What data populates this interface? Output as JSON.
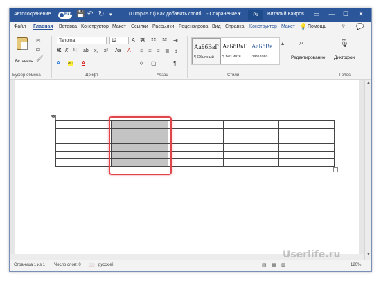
{
  "titlebar": {
    "autosave_label": "Автосохранение",
    "autosave_state": "Вкл",
    "doc_title": "(Lumpics.ru) Как добавить столб... - Сохранение...",
    "caret": "▾",
    "mini_button": "Ра",
    "user": "Виталий Каиров",
    "save_icon": "💾",
    "undo_icon": "↶",
    "redo_icon": "↻",
    "qa_more": "▾",
    "ribbon_opts_icon": "▭",
    "minimize_icon": "—",
    "maximize_icon": "☐",
    "close_icon": "✕"
  },
  "tabs": [
    {
      "label": "Файл"
    },
    {
      "label": "Главная"
    },
    {
      "label": "Вставка"
    },
    {
      "label": "Конструктор"
    },
    {
      "label": "Макет"
    },
    {
      "label": "Ссылки"
    },
    {
      "label": "Рассылки"
    },
    {
      "label": "Рецензирова"
    },
    {
      "label": "Вид"
    },
    {
      "label": "Справка"
    },
    {
      "label": "Конструктор"
    },
    {
      "label": "Макет"
    },
    {
      "label": "Помощь"
    }
  ],
  "tabs_icons": {
    "bulb": "💡",
    "share": "⇪",
    "comment": "💬"
  },
  "ribbon": {
    "clipboard": {
      "paste_label": "Вставить",
      "group_label": "Буфер обмена"
    },
    "font": {
      "name": "Tahoma",
      "size": "12",
      "group_label": "Шрифт",
      "bold": "Ж",
      "italic": "К",
      "underline": "Ч",
      "strike": "ab",
      "sub": "x₂",
      "sup": "x²",
      "grow": "A⁺",
      "shrink": "A⁻",
      "case": "Aa",
      "clear": "A",
      "effects": "A",
      "highlight": "ab",
      "color": "A"
    },
    "paragraph": {
      "group_label": "Абзац"
    },
    "styles": {
      "group_label": "Стили",
      "items": [
        {
          "sample": "АаБбВвГ",
          "name": "¶ Обычный"
        },
        {
          "sample": "АаБбВвГ",
          "name": "¶ Без инте..."
        },
        {
          "sample": "АаБбВв",
          "name": "Заголово..."
        }
      ]
    },
    "editing": {
      "label": "Редактирование",
      "icon": "⌕"
    },
    "voice": {
      "label": "Диктофон",
      "group_label": "Голос",
      "icon": "🎙"
    }
  },
  "table": {
    "rows": 6,
    "cols": 5,
    "selected_column": 2,
    "move_icon": "✥"
  },
  "statusbar": {
    "page": "Страница 1 из 1",
    "words": "Число слов: 0",
    "lang": "русский",
    "zoom": "120%"
  },
  "watermark": "Userlife.ru"
}
